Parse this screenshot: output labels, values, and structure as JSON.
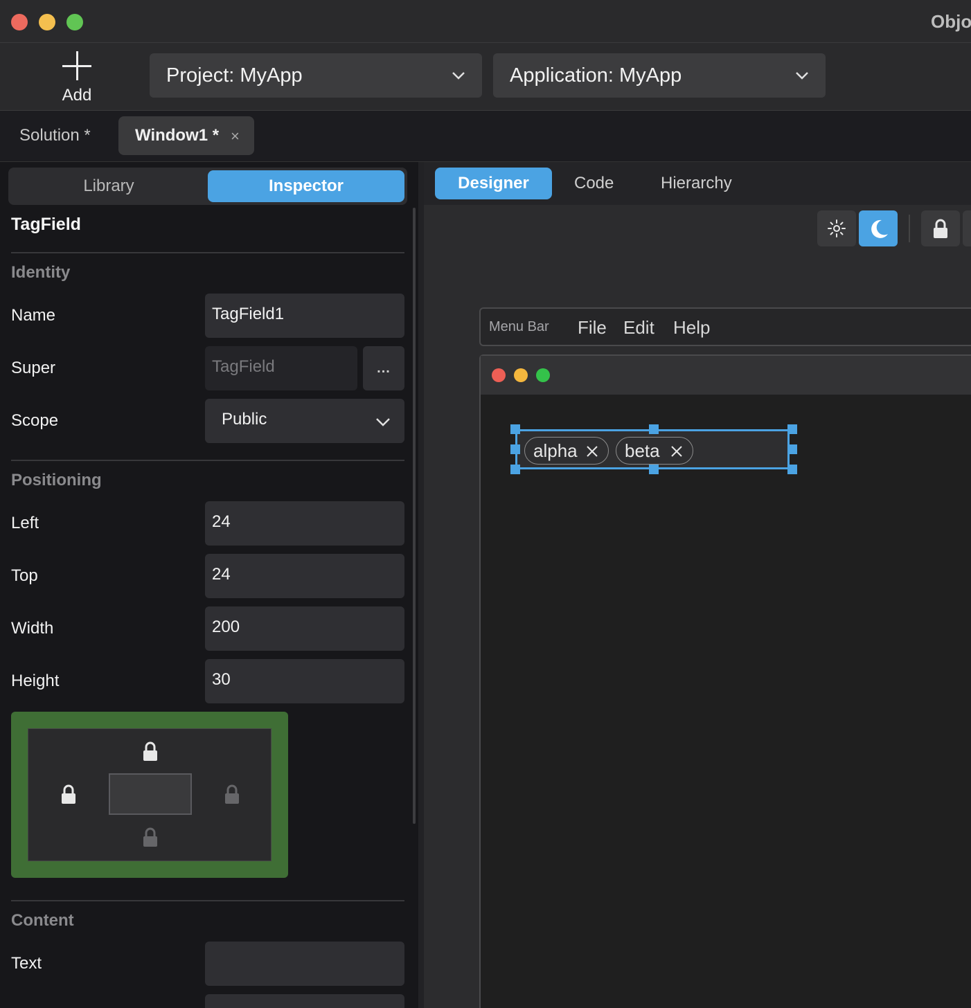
{
  "window": {
    "title": "Objo"
  },
  "toolbar": {
    "add_label": "Add",
    "project_label": "Project: MyApp",
    "application_label": "Application: MyApp"
  },
  "doc_tabs": {
    "solution": "Solution *",
    "window": "Window1 *",
    "window_close": "×"
  },
  "sidebar": {
    "tabs": [
      "Library",
      "Inspector"
    ],
    "active_tab": "Inspector",
    "class_title": "TagField",
    "sections": {
      "identity": "Identity",
      "positioning": "Positioning",
      "content": "Content"
    },
    "properties": {
      "name": {
        "label": "Name",
        "value": "TagField1"
      },
      "super": {
        "label": "Super",
        "value": "TagField",
        "button": "..."
      },
      "scope": {
        "label": "Scope",
        "value": "Public"
      },
      "left": {
        "label": "Left",
        "value": "24"
      },
      "top": {
        "label": "Top",
        "value": "24"
      },
      "width": {
        "label": "Width",
        "value": "200"
      },
      "height": {
        "label": "Height",
        "value": "30"
      },
      "text": {
        "label": "Text",
        "value": ""
      }
    },
    "locks": {
      "top": "locked",
      "left": "locked",
      "right": "unlocked",
      "bottom": "unlocked"
    },
    "colors": {
      "lock_panel": "#3f6e35",
      "accent": "#4ba3e3"
    }
  },
  "editor": {
    "tabs": [
      "Designer",
      "Code",
      "Hierarchy"
    ],
    "active_tab": "Designer",
    "toolbar_icons": [
      "sun-icon",
      "moon-icon",
      "lock-icon"
    ],
    "active_icon": "moon-icon",
    "menubar": {
      "label": "Menu Bar",
      "items": [
        "File",
        "Edit",
        "Help"
      ]
    },
    "tagfield": {
      "tags": [
        "alpha",
        "beta"
      ]
    }
  }
}
